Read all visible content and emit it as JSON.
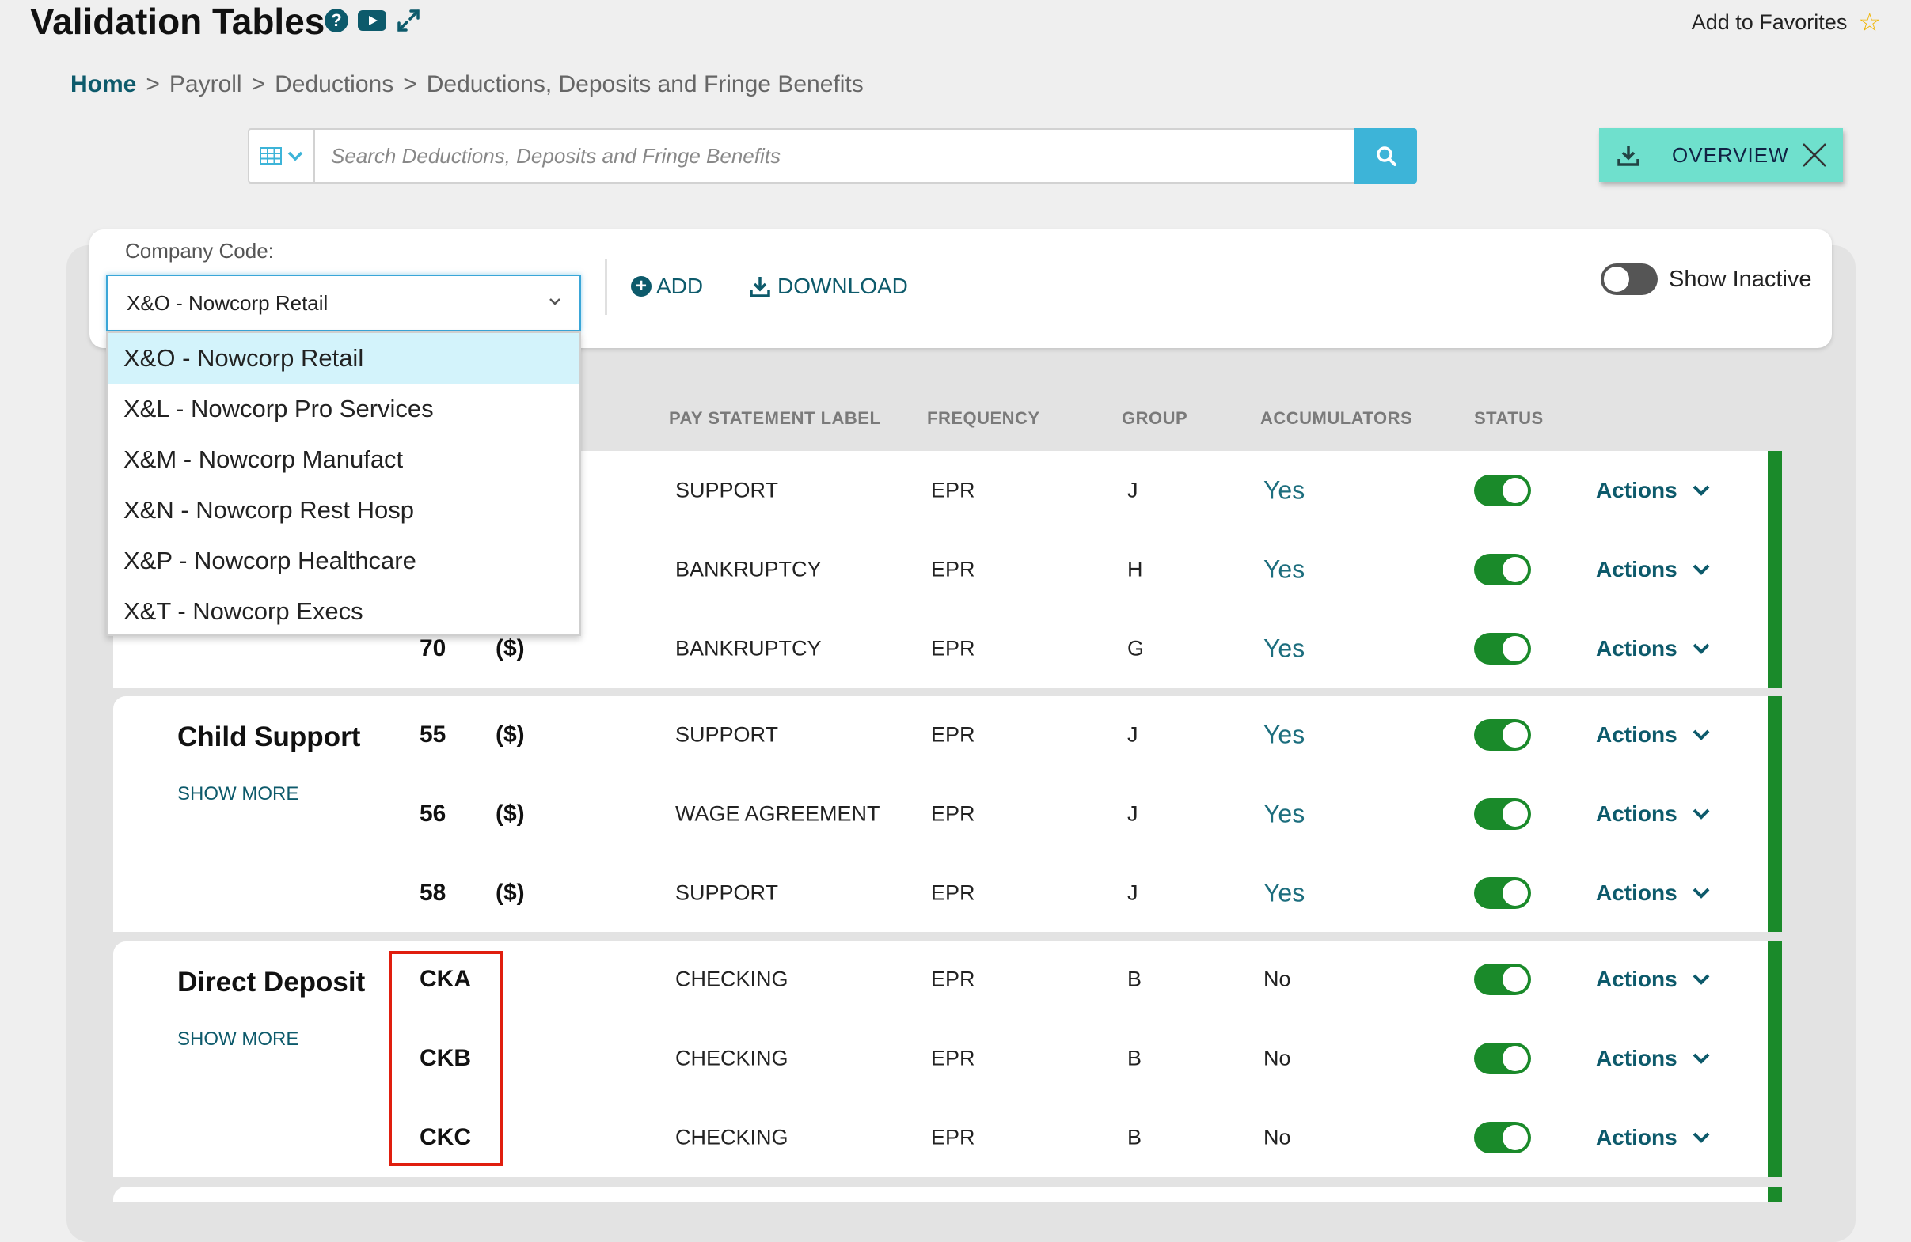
{
  "header": {
    "title": "Validation Tables",
    "favorites_label": "Add to Favorites"
  },
  "breadcrumb": {
    "home": "Home",
    "items": [
      "Payroll",
      "Deductions",
      "Deductions, Deposits and Fringe Benefits"
    ],
    "separator": ">"
  },
  "search": {
    "placeholder": "Search Deductions, Deposits and Fringe Benefits"
  },
  "overview": {
    "label": "OVERVIEW"
  },
  "company": {
    "label": "Company Code:",
    "selected": "X&O - Nowcorp Retail",
    "options": [
      "X&O - Nowcorp Retail",
      "X&L - Nowcorp Pro Services",
      "X&M - Nowcorp Manufact",
      "X&N - Nowcorp Rest Hosp",
      "X&P - Nowcorp Healthcare",
      "X&T - Nowcorp Execs"
    ]
  },
  "toolbar": {
    "add": "ADD",
    "download": "DOWNLOAD",
    "show_inactive": "Show Inactive"
  },
  "columns": {
    "pay_statement_label": "PAY STATEMENT LABEL",
    "frequency": "FREQUENCY",
    "group": "GROUP",
    "accumulators": "ACCUMULATORS",
    "status": "STATUS"
  },
  "groups": [
    {
      "title": "",
      "show_more": "",
      "rows": [
        {
          "code": "",
          "unit": "",
          "label": "SUPPORT",
          "frequency": "EPR",
          "group": "J",
          "accumulators": "Yes",
          "actions": "Actions"
        },
        {
          "code": "",
          "unit": "",
          "label": "BANKRUPTCY",
          "frequency": "EPR",
          "group": "H",
          "accumulators": "Yes",
          "actions": "Actions"
        },
        {
          "code": "70",
          "unit": "($)",
          "label": "BANKRUPTCY",
          "frequency": "EPR",
          "group": "G",
          "accumulators": "Yes",
          "actions": "Actions"
        }
      ]
    },
    {
      "title": "Child Support",
      "show_more": "SHOW MORE",
      "rows": [
        {
          "code": "55",
          "unit": "($)",
          "label": "SUPPORT",
          "frequency": "EPR",
          "group": "J",
          "accumulators": "Yes",
          "actions": "Actions"
        },
        {
          "code": "56",
          "unit": "($)",
          "label": "WAGE AGREEMENT",
          "frequency": "EPR",
          "group": "J",
          "accumulators": "Yes",
          "actions": "Actions"
        },
        {
          "code": "58",
          "unit": "($)",
          "label": "SUPPORT",
          "frequency": "EPR",
          "group": "J",
          "accumulators": "Yes",
          "actions": "Actions"
        }
      ]
    },
    {
      "title": "Direct Deposit",
      "show_more": "SHOW MORE",
      "rows": [
        {
          "code": "CKA",
          "unit": "",
          "label": "CHECKING",
          "frequency": "EPR",
          "group": "B",
          "accumulators": "No",
          "actions": "Actions"
        },
        {
          "code": "CKB",
          "unit": "",
          "label": "CHECKING",
          "frequency": "EPR",
          "group": "B",
          "accumulators": "No",
          "actions": "Actions"
        },
        {
          "code": "CKC",
          "unit": "",
          "label": "CHECKING",
          "frequency": "EPR",
          "group": "B",
          "accumulators": "No",
          "actions": "Actions"
        }
      ]
    }
  ],
  "colors": {
    "brand": "#0d5a6b",
    "accent": "#3db4d8",
    "status_active": "#1a8a2a",
    "highlight": "#e01e0e"
  },
  "icons": [
    "help-icon",
    "video-icon",
    "expand-icon",
    "star-icon",
    "grid-icon",
    "search-icon",
    "download-icon",
    "close-icon",
    "plus-icon",
    "chevron-down-icon"
  ]
}
